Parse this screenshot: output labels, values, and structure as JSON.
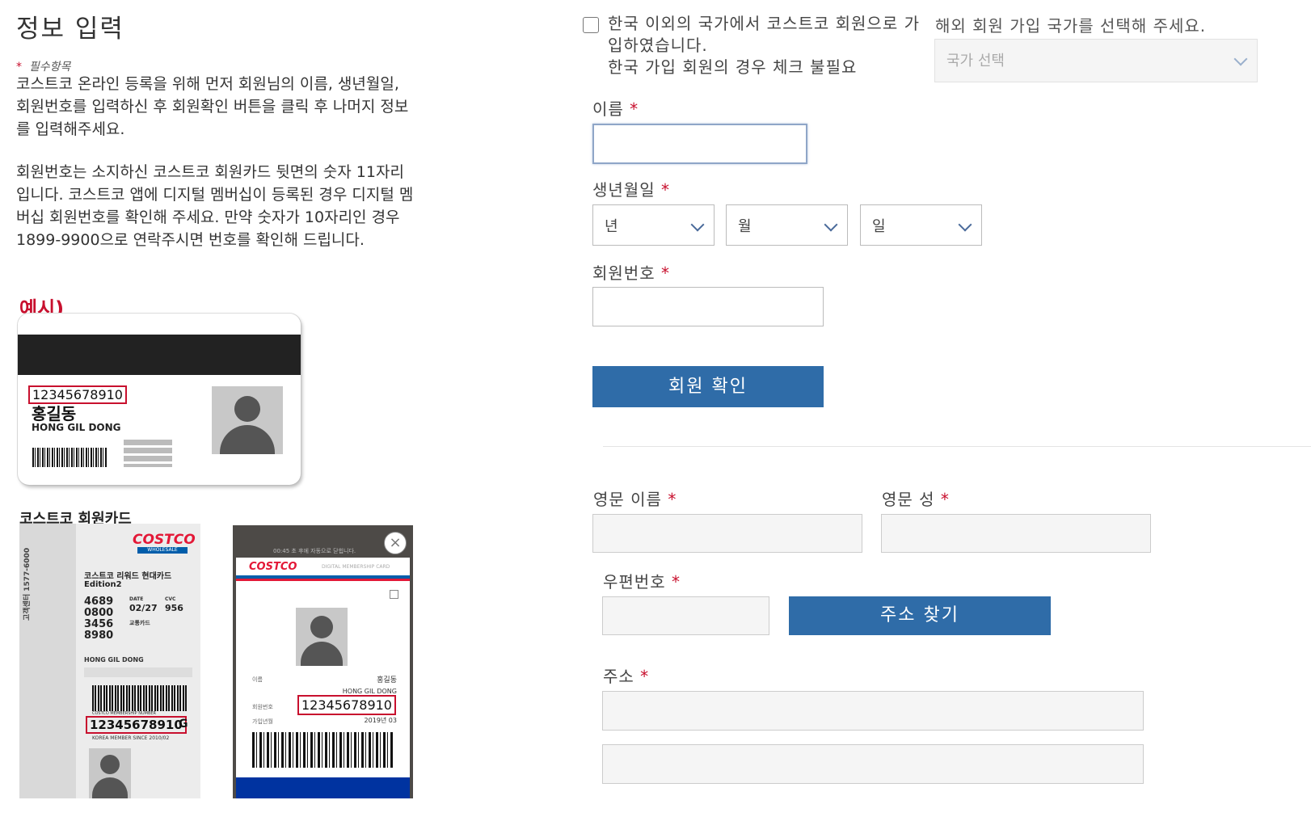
{
  "page_title": "정보 입력",
  "required_note": "필수항목",
  "intro_lines": [
    "코스트코 온라인 등록을 위해 먼저 회원님의 이름, 생년월일,",
    "회원번호를 입력하신 후 회원확인 버튼을 클릭 후 나머지 정보",
    "를 입력해주세요."
  ],
  "member_number_lines": [
    "회원번호는 소지하신 코스트코 회원카드 뒷면의 숫자 11자리",
    "입니다. 코스트코 앱에 디지털 멤버십이 등록된 경우 디지털 멤",
    "버십 회원번호를 확인해 주세요. 만약 숫자가 10자리인 경우",
    "1899-9900으로 연락주시면 번호를 확인해 드립니다."
  ],
  "example_label": "예시)",
  "member_card": {
    "number": "12345678910",
    "name_kr": "홍길동",
    "name_en": "HONG GIL DONG",
    "caption": "코스트코 회원카드"
  },
  "credit_card": {
    "brand": "COSTCO",
    "brand_sub": "WHOLESALE",
    "product": "코스트코 리워드 현대카드",
    "edition": "Edition2",
    "card_numbers": [
      "4689",
      "0800",
      "3456",
      "8980"
    ],
    "date_label": "DATE",
    "date_value": "02/27",
    "cvc_label": "CVC",
    "cvc_value": "956",
    "transit_label": "교통카드",
    "holder": "HONG GIL DONG",
    "member_number_label": "COSTCO MEMBERSHIP NUMBER",
    "member_number": "12345678910",
    "member_suffix": "G",
    "since": "KOREA MEMBER SINCE 2010/02",
    "side_text": "고객센터 1577-6000"
  },
  "digital_card": {
    "top_notice": "00:45 초 후에 자동으로 닫힙니다.",
    "brand": "COSTCO",
    "header_label": "DIGITAL MEMBERSHIP CARD",
    "name_label": "이름",
    "name_kr": "홍길동",
    "name_en": "HONG GIL DONG",
    "number_label": "회원번호",
    "number": "12345678910",
    "joined_label": "가입년월",
    "joined": "2019년 03"
  },
  "overseas": {
    "checkbox_line1": "한국 이외의 국가에서 코스트코 회원으로 가",
    "checkbox_line2": "입하였습니다.",
    "checkbox_line3": "한국 가입 회원의 경우 체크 불필요",
    "country_prompt": "해외 회원 가입 국가를 선택해 주세요.",
    "country_placeholder": "국가 선택"
  },
  "form": {
    "name_label": "이름",
    "birth_label": "생년월일",
    "year_label": "년",
    "month_label": "월",
    "day_label": "일",
    "member_no_label": "회원번호",
    "verify_button": "회원 확인",
    "eng_first_label": "영문 이름",
    "eng_last_label": "영문 성",
    "postal_label": "우편번호",
    "address_search_button": "주소 찾기",
    "address_label": "주소",
    "required_mark": "*"
  },
  "colors": {
    "accent_blue": "#2f6ca8",
    "required_red": "#c8102e",
    "costco_red": "#e31837",
    "costco_blue": "#005daa"
  }
}
